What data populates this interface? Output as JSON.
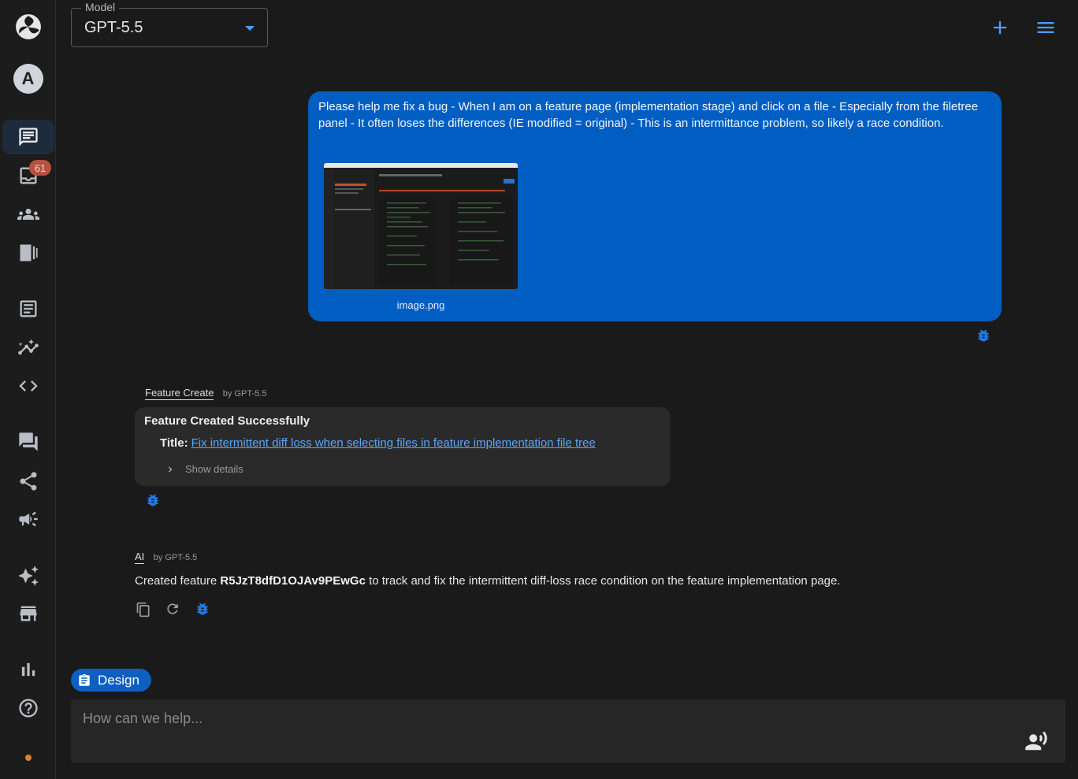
{
  "sidebar": {
    "avatar_letter": "A",
    "inbox_badge": "61"
  },
  "header": {
    "model_legend": "Model",
    "model_value": "GPT-5.5"
  },
  "user_message": {
    "text": "Please help me fix a bug - When I am on a feature page (implementation stage) and click on a file - Especially from the filetree panel - It often loses the differences (IE modified = original) - This is an intermittance problem, so likely a race condition.",
    "attachment_name": "image.png"
  },
  "tool_message": {
    "name": "Feature Create",
    "by": "by GPT-5.5",
    "heading": "Feature Created Successfully",
    "title_label": "Title:",
    "title_link": "Fix intermittent diff loss when selecting files in feature implementation file tree",
    "show_details": "Show details"
  },
  "ai_message": {
    "name": "AI",
    "by": "by GPT-5.5",
    "text_before": "Created feature ",
    "feature_id": "R5JzT8dfD1OJAv9PEwGc",
    "text_after": " to track and fix the intermittent diff-loss race condition on the feature implementation page."
  },
  "composer": {
    "chip_label": "Design",
    "placeholder": "How can we help..."
  },
  "colors": {
    "accent": "#4a9ef5",
    "user_bubble": "#005ec2",
    "badge": "#b5523f",
    "status_dot": "#d8822a"
  }
}
